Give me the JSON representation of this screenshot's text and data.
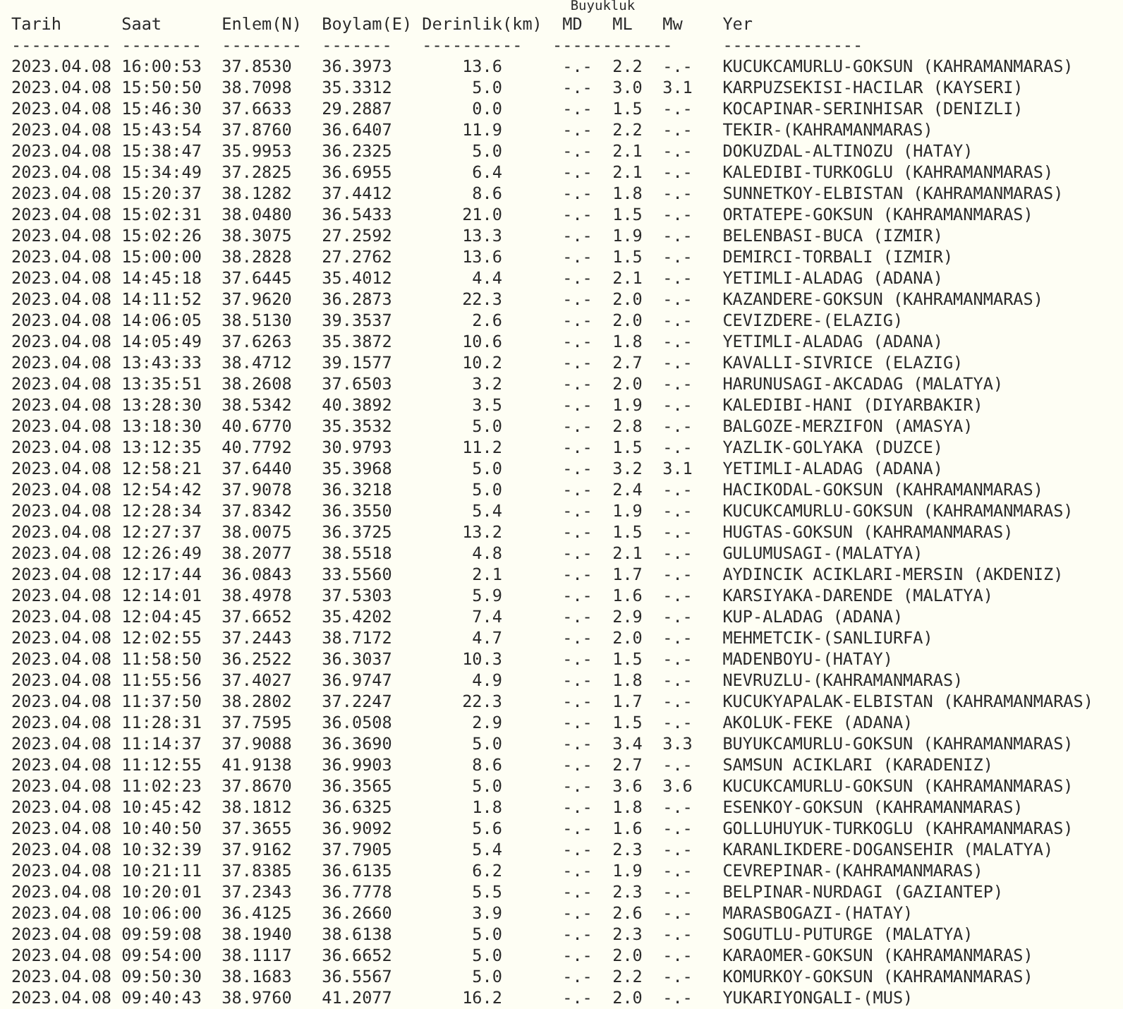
{
  "group_label": "Buyukluk",
  "columns": [
    "Tarih",
    "Saat",
    "Enlem(N)",
    "Boylam(E)",
    "Derinlik(km)",
    "MD",
    "ML",
    "Mw",
    "Yer"
  ],
  "separators": [
    "----------",
    "--------",
    "--------",
    "-------",
    "----------",
    "------------",
    "--------------"
  ],
  "rows": [
    {
      "date": "2023.04.08",
      "time": "16:00:53",
      "latitude": "37.8530",
      "longitude": "36.3973",
      "depth": "13.6",
      "md": "-.-",
      "ml": "2.2",
      "mw": "-.-",
      "location": "KUCUKCAMURLU-GOKSUN (KAHRAMANMARAS)"
    },
    {
      "date": "2023.04.08",
      "time": "15:50:50",
      "latitude": "38.7098",
      "longitude": "35.3312",
      "depth": "5.0",
      "md": "-.-",
      "ml": "3.0",
      "mw": "3.1",
      "location": "KARPUZSEKISI-HACILAR (KAYSERI)"
    },
    {
      "date": "2023.04.08",
      "time": "15:46:30",
      "latitude": "37.6633",
      "longitude": "29.2887",
      "depth": "0.0",
      "md": "-.-",
      "ml": "1.5",
      "mw": "-.-",
      "location": "KOCAPINAR-SERINHISAR (DENIZLI)"
    },
    {
      "date": "2023.04.08",
      "time": "15:43:54",
      "latitude": "37.8760",
      "longitude": "36.6407",
      "depth": "11.9",
      "md": "-.-",
      "ml": "2.2",
      "mw": "-.-",
      "location": "TEKIR-(KAHRAMANMARAS)"
    },
    {
      "date": "2023.04.08",
      "time": "15:38:47",
      "latitude": "35.9953",
      "longitude": "36.2325",
      "depth": "5.0",
      "md": "-.-",
      "ml": "2.1",
      "mw": "-.-",
      "location": "DOKUZDAL-ALTINOZU (HATAY)"
    },
    {
      "date": "2023.04.08",
      "time": "15:34:49",
      "latitude": "37.2825",
      "longitude": "36.6955",
      "depth": "6.4",
      "md": "-.-",
      "ml": "2.1",
      "mw": "-.-",
      "location": "KALEDIBI-TURKOGLU (KAHRAMANMARAS)"
    },
    {
      "date": "2023.04.08",
      "time": "15:20:37",
      "latitude": "38.1282",
      "longitude": "37.4412",
      "depth": "8.6",
      "md": "-.-",
      "ml": "1.8",
      "mw": "-.-",
      "location": "SUNNETKOY-ELBISTAN (KAHRAMANMARAS)"
    },
    {
      "date": "2023.04.08",
      "time": "15:02:31",
      "latitude": "38.0480",
      "longitude": "36.5433",
      "depth": "21.0",
      "md": "-.-",
      "ml": "1.5",
      "mw": "-.-",
      "location": "ORTATEPE-GOKSUN (KAHRAMANMARAS)"
    },
    {
      "date": "2023.04.08",
      "time": "15:02:26",
      "latitude": "38.3075",
      "longitude": "27.2592",
      "depth": "13.3",
      "md": "-.-",
      "ml": "1.9",
      "mw": "-.-",
      "location": "BELENBASI-BUCA (IZMIR)"
    },
    {
      "date": "2023.04.08",
      "time": "15:00:00",
      "latitude": "38.2828",
      "longitude": "27.2762",
      "depth": "13.6",
      "md": "-.-",
      "ml": "1.5",
      "mw": "-.-",
      "location": "DEMIRCI-TORBALI (IZMIR)"
    },
    {
      "date": "2023.04.08",
      "time": "14:45:18",
      "latitude": "37.6445",
      "longitude": "35.4012",
      "depth": "4.4",
      "md": "-.-",
      "ml": "2.1",
      "mw": "-.-",
      "location": "YETIMLI-ALADAG (ADANA)"
    },
    {
      "date": "2023.04.08",
      "time": "14:11:52",
      "latitude": "37.9620",
      "longitude": "36.2873",
      "depth": "22.3",
      "md": "-.-",
      "ml": "2.0",
      "mw": "-.-",
      "location": "KAZANDERE-GOKSUN (KAHRAMANMARAS)"
    },
    {
      "date": "2023.04.08",
      "time": "14:06:05",
      "latitude": "38.5130",
      "longitude": "39.3537",
      "depth": "2.6",
      "md": "-.-",
      "ml": "2.0",
      "mw": "-.-",
      "location": "CEVIZDERE-(ELAZIG)"
    },
    {
      "date": "2023.04.08",
      "time": "14:05:49",
      "latitude": "37.6263",
      "longitude": "35.3872",
      "depth": "10.6",
      "md": "-.-",
      "ml": "1.8",
      "mw": "-.-",
      "location": "YETIMLI-ALADAG (ADANA)"
    },
    {
      "date": "2023.04.08",
      "time": "13:43:33",
      "latitude": "38.4712",
      "longitude": "39.1577",
      "depth": "10.2",
      "md": "-.-",
      "ml": "2.7",
      "mw": "-.-",
      "location": "KAVALLI-SIVRICE (ELAZIG)"
    },
    {
      "date": "2023.04.08",
      "time": "13:35:51",
      "latitude": "38.2608",
      "longitude": "37.6503",
      "depth": "3.2",
      "md": "-.-",
      "ml": "2.0",
      "mw": "-.-",
      "location": "HARUNUSAGI-AKCADAG (MALATYA)"
    },
    {
      "date": "2023.04.08",
      "time": "13:28:30",
      "latitude": "38.5342",
      "longitude": "40.3892",
      "depth": "3.5",
      "md": "-.-",
      "ml": "1.9",
      "mw": "-.-",
      "location": "KALEDIBI-HANI (DIYARBAKIR)"
    },
    {
      "date": "2023.04.08",
      "time": "13:18:30",
      "latitude": "40.6770",
      "longitude": "35.3532",
      "depth": "5.0",
      "md": "-.-",
      "ml": "2.8",
      "mw": "-.-",
      "location": "BALGOZE-MERZIFON (AMASYA)"
    },
    {
      "date": "2023.04.08",
      "time": "13:12:35",
      "latitude": "40.7792",
      "longitude": "30.9793",
      "depth": "11.2",
      "md": "-.-",
      "ml": "1.5",
      "mw": "-.-",
      "location": "YAZLIK-GOLYAKA (DUZCE)"
    },
    {
      "date": "2023.04.08",
      "time": "12:58:21",
      "latitude": "37.6440",
      "longitude": "35.3968",
      "depth": "5.0",
      "md": "-.-",
      "ml": "3.2",
      "mw": "3.1",
      "location": "YETIMLI-ALADAG (ADANA)"
    },
    {
      "date": "2023.04.08",
      "time": "12:54:42",
      "latitude": "37.9078",
      "longitude": "36.3218",
      "depth": "5.0",
      "md": "-.-",
      "ml": "2.4",
      "mw": "-.-",
      "location": "HACIKODAL-GOKSUN (KAHRAMANMARAS)"
    },
    {
      "date": "2023.04.08",
      "time": "12:28:34",
      "latitude": "37.8342",
      "longitude": "36.3550",
      "depth": "5.4",
      "md": "-.-",
      "ml": "1.9",
      "mw": "-.-",
      "location": "KUCUKCAMURLU-GOKSUN (KAHRAMANMARAS)"
    },
    {
      "date": "2023.04.08",
      "time": "12:27:37",
      "latitude": "38.0075",
      "longitude": "36.3725",
      "depth": "13.2",
      "md": "-.-",
      "ml": "1.5",
      "mw": "-.-",
      "location": "HUGTAS-GOKSUN (KAHRAMANMARAS)"
    },
    {
      "date": "2023.04.08",
      "time": "12:26:49",
      "latitude": "38.2077",
      "longitude": "38.5518",
      "depth": "4.8",
      "md": "-.-",
      "ml": "2.1",
      "mw": "-.-",
      "location": "GULUMUSAGI-(MALATYA)"
    },
    {
      "date": "2023.04.08",
      "time": "12:17:44",
      "latitude": "36.0843",
      "longitude": "33.5560",
      "depth": "2.1",
      "md": "-.-",
      "ml": "1.7",
      "mw": "-.-",
      "location": "AYDINCIK ACIKLARI-MERSIN (AKDENIZ)"
    },
    {
      "date": "2023.04.08",
      "time": "12:14:01",
      "latitude": "38.4978",
      "longitude": "37.5303",
      "depth": "5.9",
      "md": "-.-",
      "ml": "1.6",
      "mw": "-.-",
      "location": "KARSIYAKA-DARENDE (MALATYA)"
    },
    {
      "date": "2023.04.08",
      "time": "12:04:45",
      "latitude": "37.6652",
      "longitude": "35.4202",
      "depth": "7.4",
      "md": "-.-",
      "ml": "2.9",
      "mw": "-.-",
      "location": "KUP-ALADAG (ADANA)"
    },
    {
      "date": "2023.04.08",
      "time": "12:02:55",
      "latitude": "37.2443",
      "longitude": "38.7172",
      "depth": "4.7",
      "md": "-.-",
      "ml": "2.0",
      "mw": "-.-",
      "location": "MEHMETCIK-(SANLIURFA)"
    },
    {
      "date": "2023.04.08",
      "time": "11:58:50",
      "latitude": "36.2522",
      "longitude": "36.3037",
      "depth": "10.3",
      "md": "-.-",
      "ml": "1.5",
      "mw": "-.-",
      "location": "MADENBOYU-(HATAY)"
    },
    {
      "date": "2023.04.08",
      "time": "11:55:56",
      "latitude": "37.4027",
      "longitude": "36.9747",
      "depth": "4.9",
      "md": "-.-",
      "ml": "1.8",
      "mw": "-.-",
      "location": "NEVRUZLU-(KAHRAMANMARAS)"
    },
    {
      "date": "2023.04.08",
      "time": "11:37:50",
      "latitude": "38.2802",
      "longitude": "37.2247",
      "depth": "22.3",
      "md": "-.-",
      "ml": "1.7",
      "mw": "-.-",
      "location": "KUCUKYAPALAK-ELBISTAN (KAHRAMANMARAS)"
    },
    {
      "date": "2023.04.08",
      "time": "11:28:31",
      "latitude": "37.7595",
      "longitude": "36.0508",
      "depth": "2.9",
      "md": "-.-",
      "ml": "1.5",
      "mw": "-.-",
      "location": "AKOLUK-FEKE (ADANA)"
    },
    {
      "date": "2023.04.08",
      "time": "11:14:37",
      "latitude": "37.9088",
      "longitude": "36.3690",
      "depth": "5.0",
      "md": "-.-",
      "ml": "3.4",
      "mw": "3.3",
      "location": "BUYUKCAMURLU-GOKSUN (KAHRAMANMARAS)"
    },
    {
      "date": "2023.04.08",
      "time": "11:12:55",
      "latitude": "41.9138",
      "longitude": "36.9903",
      "depth": "8.6",
      "md": "-.-",
      "ml": "2.7",
      "mw": "-.-",
      "location": "SAMSUN ACIKLARI (KARADENIZ)"
    },
    {
      "date": "2023.04.08",
      "time": "11:02:23",
      "latitude": "37.8670",
      "longitude": "36.3565",
      "depth": "5.0",
      "md": "-.-",
      "ml": "3.6",
      "mw": "3.6",
      "location": "KUCUKCAMURLU-GOKSUN (KAHRAMANMARAS)"
    },
    {
      "date": "2023.04.08",
      "time": "10:45:42",
      "latitude": "38.1812",
      "longitude": "36.6325",
      "depth": "1.8",
      "md": "-.-",
      "ml": "1.8",
      "mw": "-.-",
      "location": "ESENKOY-GOKSUN (KAHRAMANMARAS)"
    },
    {
      "date": "2023.04.08",
      "time": "10:40:50",
      "latitude": "37.3655",
      "longitude": "36.9092",
      "depth": "5.6",
      "md": "-.-",
      "ml": "1.6",
      "mw": "-.-",
      "location": "GOLLUHUYUK-TURKOGLU (KAHRAMANMARAS)"
    },
    {
      "date": "2023.04.08",
      "time": "10:32:39",
      "latitude": "37.9162",
      "longitude": "37.7905",
      "depth": "5.4",
      "md": "-.-",
      "ml": "2.3",
      "mw": "-.-",
      "location": "KARANLIKDERE-DOGANSEHIR (MALATYA)"
    },
    {
      "date": "2023.04.08",
      "time": "10:21:11",
      "latitude": "37.8385",
      "longitude": "36.6135",
      "depth": "6.2",
      "md": "-.-",
      "ml": "1.9",
      "mw": "-.-",
      "location": "CEVREPINAR-(KAHRAMANMARAS)"
    },
    {
      "date": "2023.04.08",
      "time": "10:20:01",
      "latitude": "37.2343",
      "longitude": "36.7778",
      "depth": "5.5",
      "md": "-.-",
      "ml": "2.3",
      "mw": "-.-",
      "location": "BELPINAR-NURDAGI (GAZIANTEP)"
    },
    {
      "date": "2023.04.08",
      "time": "10:06:00",
      "latitude": "36.4125",
      "longitude": "36.2660",
      "depth": "3.9",
      "md": "-.-",
      "ml": "2.6",
      "mw": "-.-",
      "location": "MARASBOGAZI-(HATAY)"
    },
    {
      "date": "2023.04.08",
      "time": "09:59:08",
      "latitude": "38.1940",
      "longitude": "38.6138",
      "depth": "5.0",
      "md": "-.-",
      "ml": "2.3",
      "mw": "-.-",
      "location": "SOGUTLU-PUTURGE (MALATYA)"
    },
    {
      "date": "2023.04.08",
      "time": "09:54:00",
      "latitude": "38.1117",
      "longitude": "36.6652",
      "depth": "5.0",
      "md": "-.-",
      "ml": "2.0",
      "mw": "-.-",
      "location": "KARAOMER-GOKSUN (KAHRAMANMARAS)"
    },
    {
      "date": "2023.04.08",
      "time": "09:50:30",
      "latitude": "38.1683",
      "longitude": "36.5567",
      "depth": "5.0",
      "md": "-.-",
      "ml": "2.2",
      "mw": "-.-",
      "location": "KOMURKOY-GOKSUN (KAHRAMANMARAS)"
    },
    {
      "date": "2023.04.08",
      "time": "09:40:43",
      "latitude": "38.9760",
      "longitude": "41.2077",
      "depth": "16.2",
      "md": "-.-",
      "ml": "2.0",
      "mw": "-.-",
      "location": "YUKARIYONGALI-(MUS)"
    }
  ]
}
